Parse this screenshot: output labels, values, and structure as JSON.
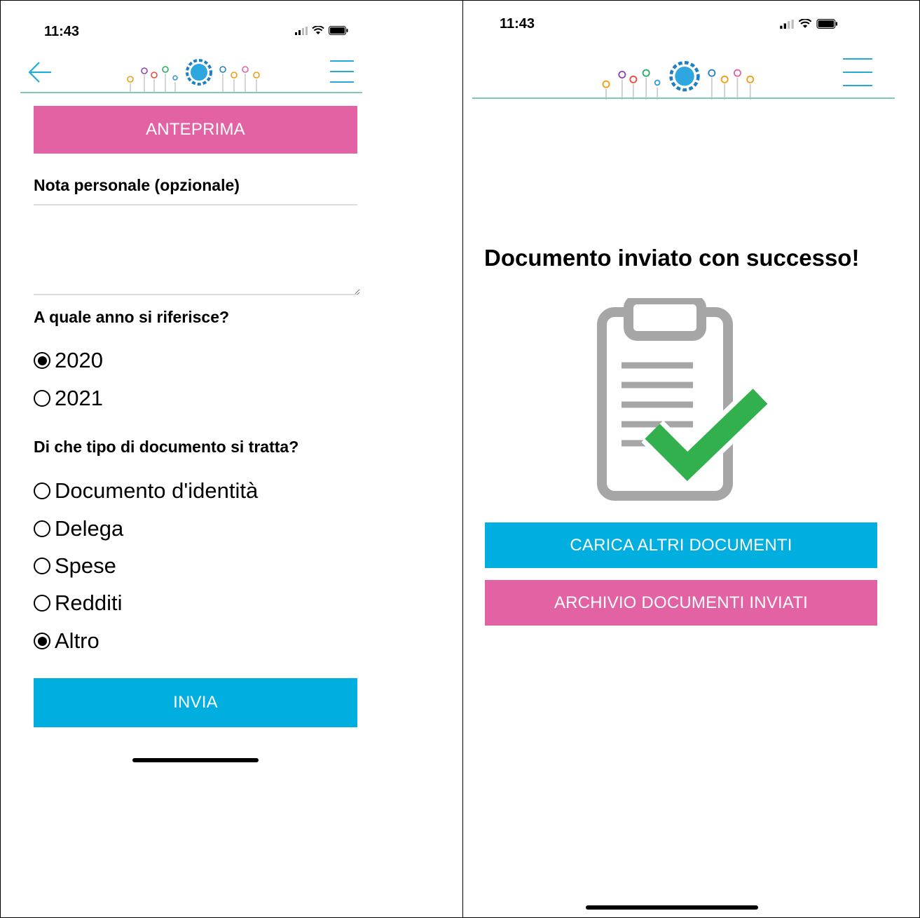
{
  "left_screen": {
    "status_bar": {
      "time": "11:43"
    },
    "header": {
      "logo_icon": "flower-logo",
      "back_icon": "arrow-left-icon",
      "menu_icon": "hamburger-icon"
    },
    "preview_button": "ANTEPRIMA",
    "note": {
      "label": "Nota personale (opzionale)",
      "value": ""
    },
    "year": {
      "question": "A quale anno si riferisce?",
      "options": [
        "2020",
        "2021"
      ],
      "selected": "2020"
    },
    "doc_type": {
      "question": "Di che tipo di documento si tratta?",
      "options": [
        "Documento d'identità",
        "Delega",
        "Spese",
        "Redditi",
        "Altro"
      ],
      "selected": "Altro"
    },
    "send_button": "INVIA"
  },
  "right_screen": {
    "status_bar": {
      "time": "11:43"
    },
    "header": {
      "logo_icon": "flower-logo",
      "menu_icon": "hamburger-icon"
    },
    "success_message": "Documento inviato con successo!",
    "illustration_icon": "clipboard-check-icon",
    "upload_more_button": "CARICA ALTRI DOCUMENTI",
    "archive_button": "ARCHIVIO DOCUMENTI INVIATI"
  },
  "colors": {
    "pink": "#e262a4",
    "blue": "#00aedf",
    "accent_line": "#7ec8be",
    "check_green": "#33b04e",
    "clipboard_gray": "#a6a6a6"
  }
}
